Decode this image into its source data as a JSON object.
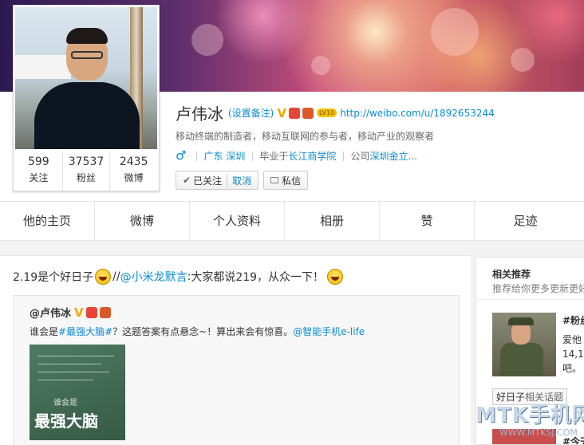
{
  "profile": {
    "name": "卢伟冰",
    "remark": "(设置备注)",
    "verified": "V",
    "level": "LV10",
    "url": "http://weibo.com/u/1892653244",
    "bio": "移动终端的制造者，移动互联网的参与者，移动产业的观察者",
    "gender_icon": "♂",
    "location": "广东 深圳",
    "edu_prefix": "毕业于",
    "edu_school": "长江商学院",
    "company_prefix": "公司",
    "company": "深圳金立...",
    "stats": [
      {
        "num": "599",
        "label": "关注"
      },
      {
        "num": "37537",
        "label": "粉丝"
      },
      {
        "num": "2435",
        "label": "微博"
      }
    ],
    "followed_label": "已关注",
    "cancel_label": "取消",
    "message_label": "私信"
  },
  "tabs": [
    "他的主页",
    "微博",
    "个人资料",
    "相册",
    "赞",
    "足迹"
  ],
  "feed": {
    "post_prefix": "2.19是个好日子",
    "post_sep": "//",
    "post_mention": "@小米龙默言",
    "post_colon": ":",
    "post_rest": "大家都说219，从众一下！",
    "repost_author": "@卢伟冰",
    "repost_text_1": "谁会是",
    "repost_tag": "#最强大脑#",
    "repost_text_2": "？这题答案有点悬念~！算出来会有惊喜。",
    "repost_mention": "@智能手机e-life",
    "image_small": "谁会是",
    "image_big": "最强大脑"
  },
  "sidebar": {
    "title": "相关推荐",
    "subtitle": "推荐给你更多更新更好",
    "item_name": "#粉丝",
    "item_desc": "爱他\n14,1\n吧。",
    "tag_label": "好日子",
    "tag_suffix": "相关话题",
    "item2_name": "#今天"
  },
  "watermark": {
    "main": "MTK手机网",
    "sub": "WWW.MTKSJ.COM"
  },
  "colors": {
    "link": "#0a8cd2",
    "verified": "#f2a900"
  }
}
